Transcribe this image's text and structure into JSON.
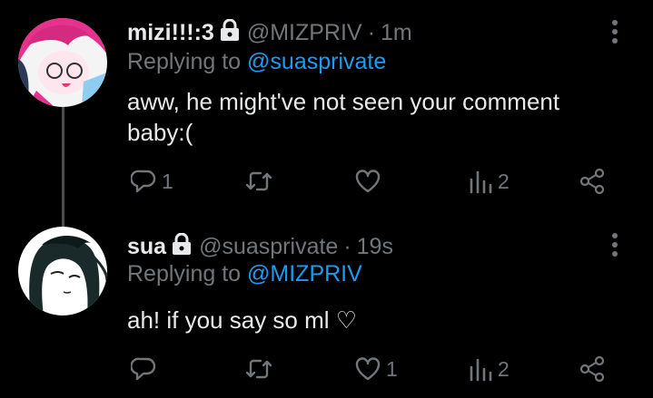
{
  "tweets": [
    {
      "name": "mizi!!!:3",
      "handle": "@MIZPRIV",
      "time": "1m",
      "reply_prefix": "Replying to",
      "reply_mention": "@suasprivate",
      "text": "aww, he might've not seen your comment baby:(",
      "reply_count": "1",
      "retweet_count": "",
      "like_count": "",
      "views_count": "2"
    },
    {
      "name": "sua",
      "handle": "@suasprivate",
      "time": "19s",
      "reply_prefix": "Replying to",
      "reply_mention": "@MIZPRIV",
      "text": "ah! if you say so ml ♡",
      "reply_count": "",
      "retweet_count": "",
      "like_count": "1",
      "views_count": "2"
    }
  ],
  "separator": "·",
  "icons": {
    "lock": "lock-icon",
    "more": "more-vertical-icon",
    "reply": "reply-icon",
    "retweet": "retweet-icon",
    "like": "heart-icon",
    "views": "views-icon",
    "share": "share-icon"
  },
  "colors": {
    "background": "#000000",
    "text": "#e7e9ea",
    "muted": "#71767b",
    "mention": "#1d9bf0",
    "thread_line": "#4a4d50"
  }
}
